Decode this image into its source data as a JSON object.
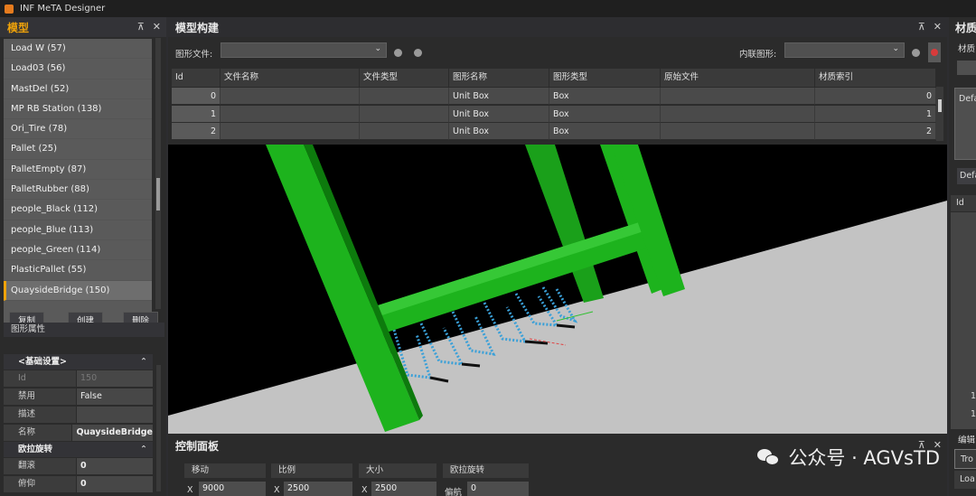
{
  "title_bar": {
    "app_title": "INF MeTA Designer"
  },
  "left_panel": {
    "title": "模型",
    "models": [
      "Load W (57)",
      "Load03 (56)",
      "MastDel (52)",
      "MP RB Station (138)",
      "Ori_Tire (78)",
      "Pallet (25)",
      "PalletEmpty (87)",
      "PalletRubber (88)",
      "people_Black (112)",
      "people_Blue (113)",
      "people_Green (114)",
      "PlasticPallet (55)",
      "QuaysideBridge (150)"
    ],
    "selected_index": 12,
    "buttons": {
      "copy": "复制",
      "create": "创建",
      "delete": "删除"
    },
    "properties": {
      "title": "图形属性",
      "basic_group": "<基础设置>",
      "id_label": "Id",
      "id_value": "150",
      "disabled_label": "禁用",
      "disabled_value": "False",
      "desc_label": "描述",
      "desc_value": "",
      "name_label": "名称",
      "name_value": "QuaysideBridge",
      "euler_group": "欧拉旋转",
      "roll_label": "翻滚",
      "roll_value": "0",
      "pitch_label": "俯仰",
      "pitch_value": "0"
    }
  },
  "center_panel": {
    "title": "模型构建",
    "shape_file_label": "图形文件:",
    "inline_shape_label": "内联图形:",
    "table": {
      "headers": [
        "Id",
        "文件名称",
        "文件类型",
        "图形名称",
        "图形类型",
        "原始文件",
        "材质索引"
      ],
      "rows": [
        [
          "0",
          "",
          "",
          "Unit Box",
          "Box",
          "",
          "0"
        ],
        [
          "1",
          "",
          "",
          "Unit Box",
          "Box",
          "",
          "1"
        ],
        [
          "2",
          "",
          "",
          "Unit Box",
          "Box",
          "",
          "2"
        ]
      ]
    }
  },
  "control_panel": {
    "title": "控制面板",
    "move": {
      "label": "移动",
      "axis": "X",
      "value": "9000"
    },
    "scale": {
      "label": "比例",
      "axis": "X",
      "value": "2500"
    },
    "size": {
      "label": "大小",
      "axis": "X",
      "value": "2500"
    },
    "euler": {
      "label": "欧拉旋转",
      "axis": "偏航",
      "value": "0"
    }
  },
  "right_panel": {
    "title": "材质",
    "sub_label": "材质",
    "default1": "Defa",
    "default2": "Defa",
    "id_header": "Id",
    "row1": "1",
    "row2": "1",
    "edit_label": "编辑",
    "field1": "Tro",
    "field2": "Loa"
  },
  "watermark": {
    "text": "公众号 · AGVsTD"
  },
  "colors": {
    "accent": "#f0a30a",
    "model_green": "#1db31d",
    "rack_blue": "#3aa0d8",
    "floor": "#c3c3c3"
  }
}
